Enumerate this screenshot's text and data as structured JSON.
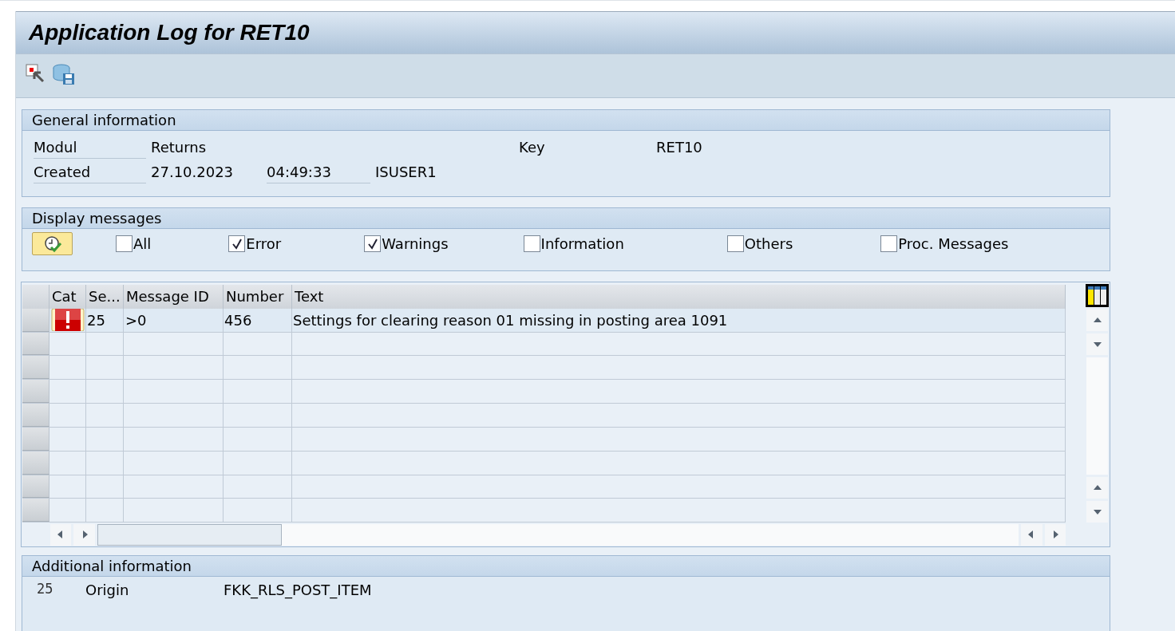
{
  "window": {
    "title": "Application Log for RET10"
  },
  "general_information": {
    "title": "General information",
    "rows": [
      {
        "label": "Modul",
        "value": "Returns",
        "key_label": "Key",
        "key_value": "RET10"
      },
      {
        "label": "Created",
        "value": "27.10.2023",
        "time": "04:49:33",
        "user": "ISUSER1"
      }
    ]
  },
  "display_messages": {
    "title": "Display messages",
    "filters": [
      {
        "label": "All",
        "checked": false
      },
      {
        "label": "Error",
        "checked": true
      },
      {
        "label": "Warnings",
        "checked": true
      },
      {
        "label": "Information",
        "checked": false
      },
      {
        "label": "Others",
        "checked": false
      },
      {
        "label": "Proc. Messages",
        "checked": false
      }
    ]
  },
  "table": {
    "columns": [
      "Cat",
      "Se...",
      "Message ID",
      "Number",
      "Text"
    ],
    "rows": [
      {
        "kind": "error",
        "sequence": "25",
        "message_id": ">0",
        "number": "456",
        "text": "Settings for clearing reason 01 missing in posting area 1091"
      }
    ]
  },
  "additional_information": {
    "title": "Additional information",
    "rows": [
      {
        "number": "25",
        "label": "Origin",
        "value": "FKK_RLS_POST_ITEM"
      }
    ]
  }
}
